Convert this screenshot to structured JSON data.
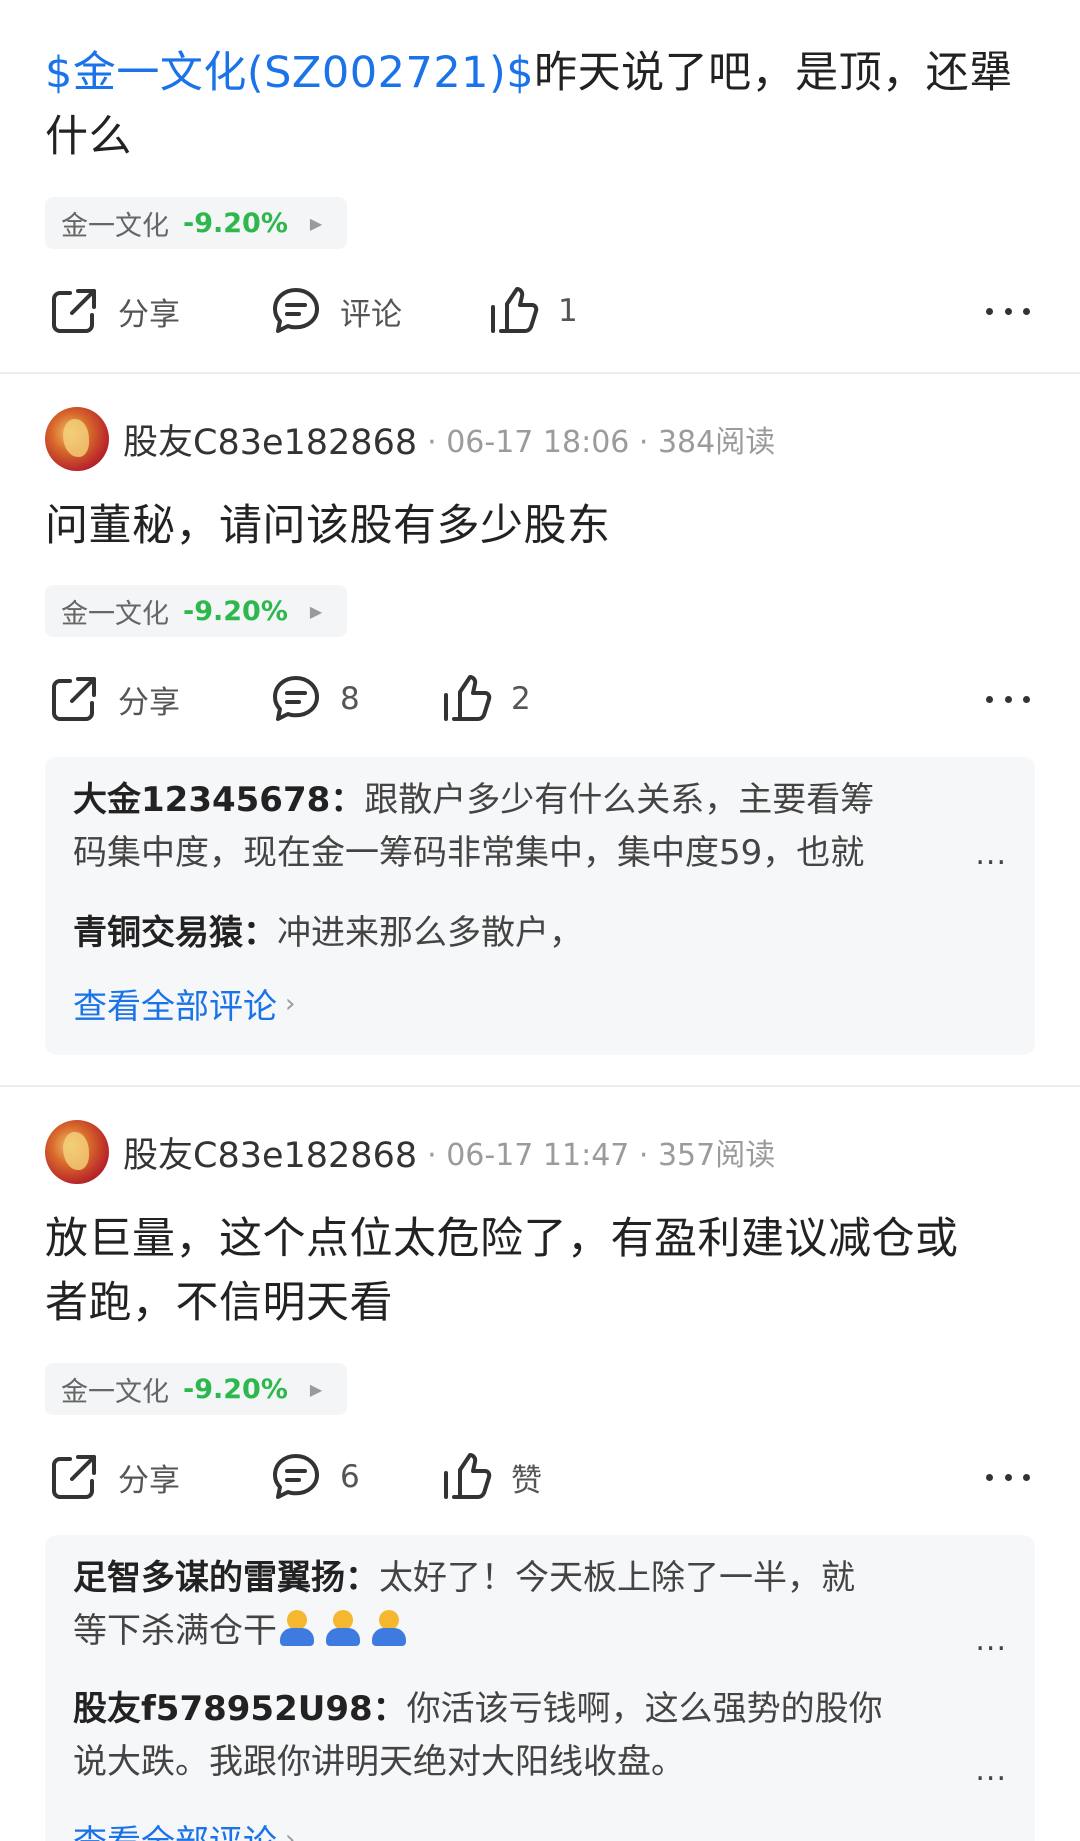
{
  "posts": [
    {
      "cashtag": "$金一文化(SZ002721)$",
      "text": "昨天说了吧，是顶，还犟什么",
      "stock": {
        "name": "金一文化",
        "change": "-9.20%"
      },
      "actions": {
        "share": "分享",
        "comment": "评论",
        "like": "1"
      }
    },
    {
      "user": "股友C83e182868",
      "meta": "· 06-17 18:06 · 384阅读",
      "text": "问董秘，请问该股有多少股东",
      "stock": {
        "name": "金一文化",
        "change": "-9.20%"
      },
      "actions": {
        "share": "分享",
        "comment": "8",
        "like": "2"
      },
      "comments": [
        {
          "author": "大金12345678：",
          "line1": "跟散户多少有什么关系，主要看筹",
          "line2": "码集中度，现在金一筹码非常集中，集中度59，也就"
        },
        {
          "author": "青铜交易猿：",
          "text": "冲进来那么多散户，"
        }
      ],
      "view_all": "查看全部评论"
    },
    {
      "user": "股友C83e182868",
      "meta": "· 06-17 11:47 · 357阅读",
      "text_line1": "放巨量，这个点位太危险了，有盈利建议减仓或",
      "text_line2": "者跑，不信明天看",
      "stock": {
        "name": "金一文化",
        "change": "-9.20%"
      },
      "actions": {
        "share": "分享",
        "comment": "6",
        "like": "赞"
      },
      "comments": [
        {
          "author": "足智多谋的雷翼扬：",
          "line1": "太好了！今天板上除了一半，就",
          "line2": "等下杀满仓干"
        },
        {
          "author": "股友f578952U98：",
          "line1": "你活该亏钱啊，这么强势的股你",
          "line2": "说大跌。我跟你讲明天绝对大阳线收盘。"
        }
      ],
      "view_all": "查看全部评论"
    }
  ],
  "ui": {
    "ellipsis": "...",
    "tag_arrow": "▶",
    "chevron": "›"
  },
  "colors": {
    "link": "#1a73e8",
    "down_green": "#2db84d",
    "comment_bg": "#f6f7f9"
  },
  "icons": [
    "share-icon",
    "comment-icon",
    "thumbs-up-icon",
    "more-icon",
    "avatar-dragon",
    "shrug-emoji"
  ]
}
